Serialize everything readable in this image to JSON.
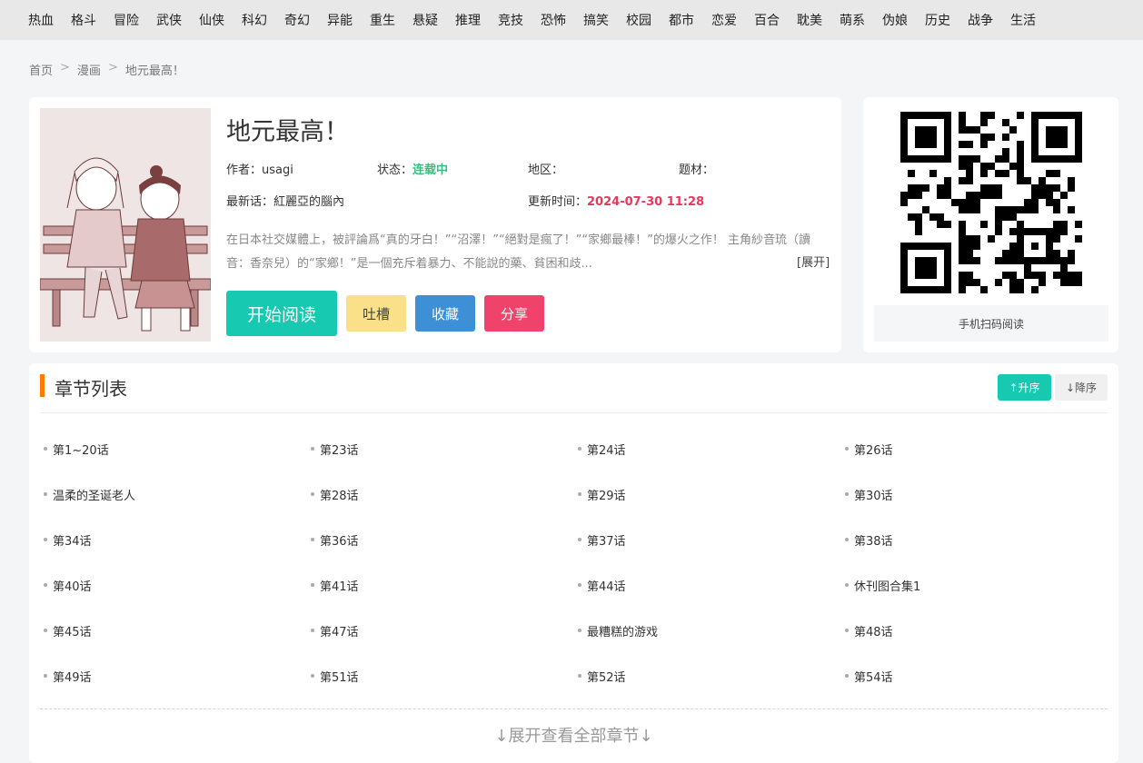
{
  "nav": [
    "热血",
    "格斗",
    "冒险",
    "武侠",
    "仙侠",
    "科幻",
    "奇幻",
    "异能",
    "重生",
    "悬疑",
    "推理",
    "竞技",
    "恐怖",
    "搞笑",
    "校园",
    "都市",
    "恋爱",
    "百合",
    "耽美",
    "萌系",
    "伪娘",
    "历史",
    "战争",
    "生活"
  ],
  "breadcrumb": {
    "home": "首页",
    "sep": ">",
    "category": "漫画",
    "current": "地元最高！"
  },
  "comic": {
    "title": "地元最高！",
    "author_label": "作者：",
    "author": "usagi",
    "status_label": "状态：",
    "status": "连载中",
    "region_label": "地区：",
    "region": "",
    "genre_label": "题材：",
    "genre": "",
    "latest_label": "最新话：",
    "latest": "紅麗亞的腦內",
    "updated_label": "更新时间：",
    "updated": "2024-07-30 11:28",
    "description": "在日本社交媒體上，被評論爲“真的牙白！”“沼澤！”“絕對是瘋了！”“家鄉最棒！”的爆火之作！ 主角紗音琉（讀音：香奈兒）的“家鄉！”是一個充斥着暴力、不能說的藥、貧困和歧...",
    "expand": "[展开]"
  },
  "actions": {
    "read": "开始阅读",
    "comment": "吐槽",
    "favorite": "收藏",
    "share": "分享"
  },
  "qr": {
    "caption": "手机扫码阅读"
  },
  "chapters": {
    "title": "章节列表",
    "sort_asc": "↑升序",
    "sort_desc": "↓降序",
    "items": [
      "第1~20话",
      "第23话",
      "第24话",
      "第26话",
      "温柔的圣诞老人",
      "第28话",
      "第29话",
      "第30话",
      "第34话",
      "第36话",
      "第37话",
      "第38话",
      "第40话",
      "第41话",
      "第44话",
      "休刊图合集1",
      "第45话",
      "第47话",
      "最糟糕的游戏",
      "第48话",
      "第49话",
      "第51话",
      "第52话",
      "第54话"
    ],
    "expand_all": "↓展开查看全部章节↓"
  },
  "colors": {
    "accent": "#16c9b0",
    "status": "#2ec27e",
    "date": "#e8375a",
    "bar": "#ff7a00"
  }
}
